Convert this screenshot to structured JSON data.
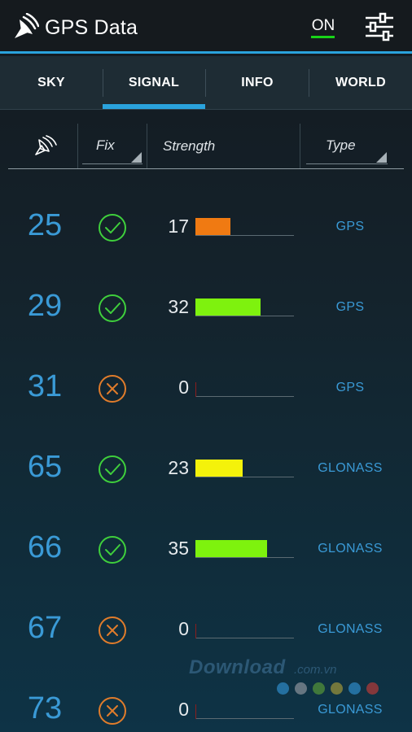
{
  "app": {
    "title": "GPS Data",
    "toggle_label": "ON"
  },
  "tabs": [
    {
      "label": "SKY"
    },
    {
      "label": "SIGNAL"
    },
    {
      "label": "INFO"
    },
    {
      "label": "WORLD"
    }
  ],
  "selected_tab": "SIGNAL",
  "columns": {
    "fix": "Fix",
    "strength": "Strength",
    "type": "Type"
  },
  "satellites": [
    {
      "prn": "25",
      "fix": "check",
      "snr": "17",
      "strength": 17,
      "bar_color": "#f07a12",
      "type": "GPS"
    },
    {
      "prn": "29",
      "fix": "check",
      "snr": "32",
      "strength": 32,
      "bar_color": "#7ef20e",
      "type": "GPS"
    },
    {
      "prn": "31",
      "fix": "cross",
      "snr": "0",
      "strength": 0,
      "bar_color": "#f07a12",
      "type": "GPS"
    },
    {
      "prn": "65",
      "fix": "check",
      "snr": "23",
      "strength": 23,
      "bar_color": "#f4f20a",
      "type": "GLONASS"
    },
    {
      "prn": "66",
      "fix": "check",
      "snr": "35",
      "strength": 35,
      "bar_color": "#7ef20e",
      "type": "GLONASS"
    },
    {
      "prn": "67",
      "fix": "cross",
      "snr": "0",
      "strength": 0,
      "bar_color": "#f07a12",
      "type": "GLONASS"
    },
    {
      "prn": "73",
      "fix": "cross",
      "snr": "0",
      "strength": 0,
      "bar_color": "#f07a12",
      "type": "GLONASS"
    }
  ],
  "watermark": {
    "text": "Download",
    "suffix": ".com.vn"
  },
  "colors": {
    "accent": "#2aa3dd",
    "fix_ok": "#3fcf3c",
    "fix_none": "#e07c2b",
    "toggle_on": "#18d418",
    "prn_text": "#3a9ad6"
  }
}
